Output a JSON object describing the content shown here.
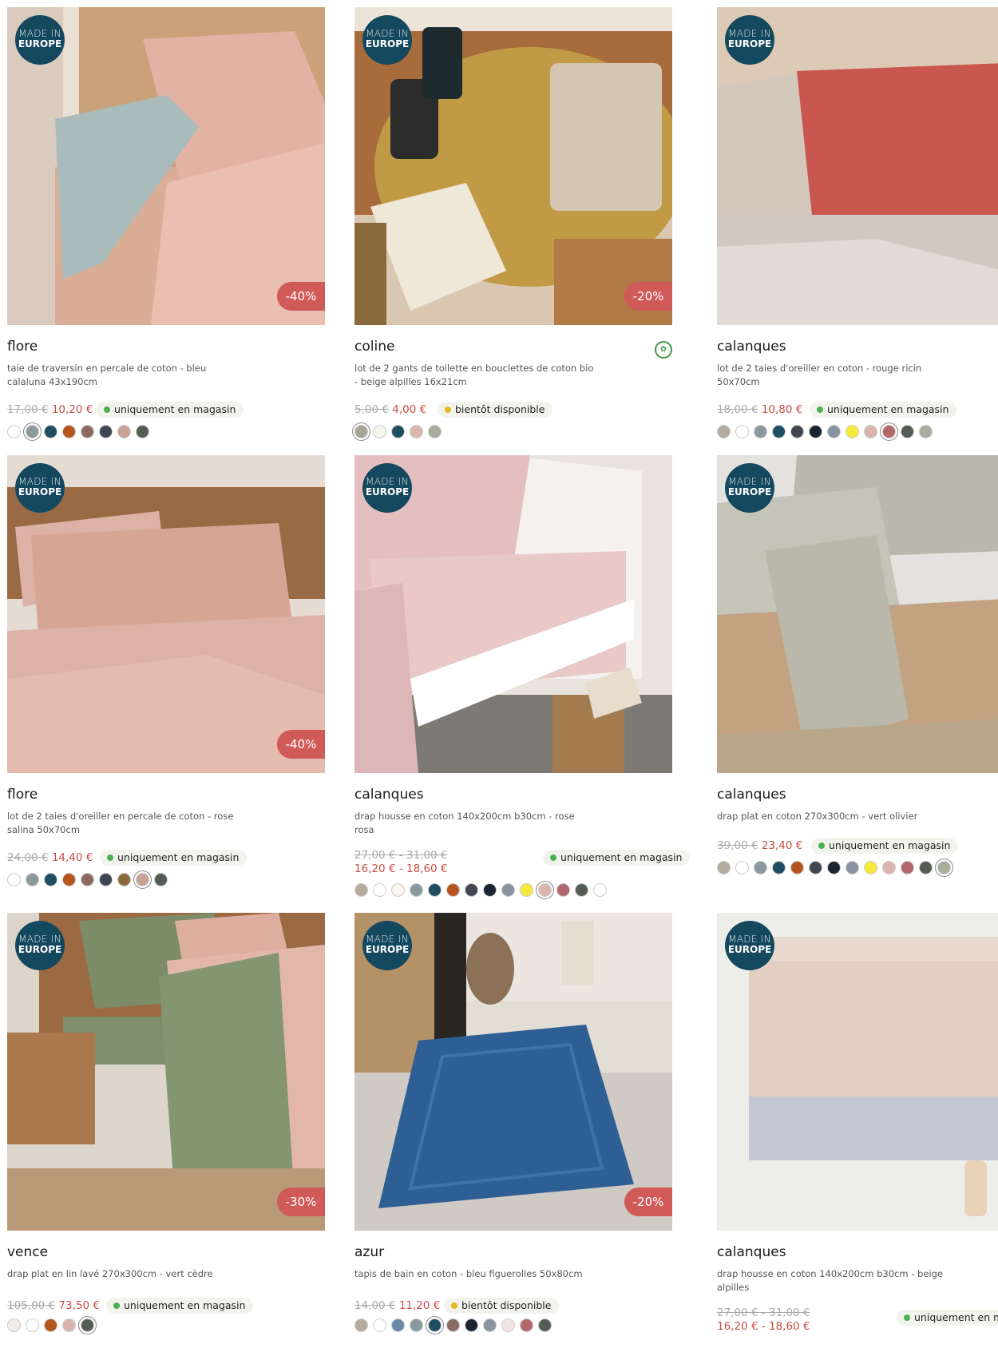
{
  "products": [
    {
      "brand": "flore",
      "desc": "taie de traversin en percale de coton - bleu calaluna 43x190cm",
      "old_price": "17,00 €",
      "new_price": "10,20 €",
      "discount": "-40%",
      "badge_l1": "MADE IN",
      "badge_l2": "EUROPE",
      "stock": "uniquement en magasin",
      "stock_color": "#4caf50",
      "swatches": [
        "#ffffff",
        "#8a9a9c",
        "#1f4e63",
        "#b4541f",
        "#8b6b60",
        "#404554",
        "#c9a394",
        "#535d55"
      ],
      "selected": 1
    },
    {
      "brand": "coline",
      "desc": "lot de 2 gants de toilette en bouclettes de coton bio - beige alpilles 16x21cm",
      "old_price": "5,00 €",
      "new_price": "4,00 €",
      "discount": "-20%",
      "badge_l1": "MADE IN",
      "badge_l2": "EUROPE",
      "stock": "bientôt disponible",
      "stock_color": "#e3b81f",
      "swatches": [
        "#a6a597",
        "#f7f5ea",
        "#1f4e63",
        "#d9b5ae",
        "#a9ad9b"
      ],
      "selected": 0,
      "bio_icon": "organic-certification-icon"
    },
    {
      "brand": "calanques",
      "desc": "lot de 2 taies d'oreiller en coton - rouge ricin 50x70cm",
      "old_price": "18,00 €",
      "new_price": "10,80 €",
      "discount": "",
      "badge_l1": "MADE IN",
      "badge_l2": "EUROPE",
      "stock": "uniquement en magasin",
      "stock_color": "#4caf50",
      "swatches": [
        "#b4ac9e",
        "#ffffff",
        "#8a9a9c",
        "#1f4e63",
        "#454750",
        "#1b2431",
        "#8a93a0",
        "#f5ea3c",
        "#d9b5ae",
        "#b3676a",
        "#535d55",
        "#a9ad9b"
      ],
      "selected": 9
    },
    {
      "brand": "flore",
      "desc": "lot de 2 taies d'oreiller en percale de coton - rose salina 50x70cm",
      "old_price": "24,00 €",
      "new_price": "14,40 €",
      "discount": "-40%",
      "badge_l1": "MADE IN",
      "badge_l2": "EUROPE",
      "stock": "uniquement en magasin",
      "stock_color": "#4caf50",
      "swatches": [
        "#ffffff",
        "#8a9a9c",
        "#1f4e63",
        "#b4541f",
        "#8b6b60",
        "#404554",
        "#8a6a3c",
        "#c9a394",
        "#535d55"
      ],
      "selected": 7
    },
    {
      "brand": "calanques",
      "desc": "drap housse en coton 140x200cm b30cm - rose rosa",
      "old_price": "27,00 € - 31,00 €",
      "new_price": "16,20 € - 18,60 €",
      "discount": "",
      "badge_l1": "MADE IN",
      "badge_l2": "EUROPE",
      "stock": "uniquement en magasin",
      "stock_color": "#4caf50",
      "swatches": [
        "#b4ac9e",
        "#ffffff",
        "#f7f5ea",
        "#8a9a9c",
        "#1f4e63",
        "#b4541f",
        "#454750",
        "#1b2431",
        "#8a93a0",
        "#f5ea3c",
        "#d9b5ae",
        "#b3676a",
        "#535d55",
        "#ffffff"
      ],
      "selected": 10
    },
    {
      "brand": "calanques",
      "desc": "drap plat en coton 270x300cm - vert olivier",
      "old_price": "39,00 €",
      "new_price": "23,40 €",
      "discount": "",
      "badge_l1": "MADE IN",
      "badge_l2": "EUROPE",
      "stock": "uniquement en magasin",
      "stock_color": "#4caf50",
      "swatches": [
        "#b4ac9e",
        "#ffffff",
        "#8a9a9c",
        "#1f4e63",
        "#b4541f",
        "#454750",
        "#1b2431",
        "#8a93a0",
        "#f5ea3c",
        "#d9b5ae",
        "#b3676a",
        "#535d55",
        "#a9ad9b"
      ],
      "selected": 12
    },
    {
      "brand": "vence",
      "desc": "drap plat en lin lavé 270x300cm - vert cèdre",
      "old_price": "105,00 €",
      "new_price": "73,50 €",
      "discount": "-30%",
      "badge_l1": "MADE IN",
      "badge_l2": "EUROPE",
      "stock": "uniquement en magasin",
      "stock_color": "#4caf50",
      "swatches": [
        "#f3ede5",
        "#ffffff",
        "#b4541f",
        "#d9b5ae",
        "#535d55"
      ],
      "selected": 4
    },
    {
      "brand": "azur",
      "desc": "tapis de bain en coton - bleu figuerolles 50x80cm",
      "old_price": "14,00 €",
      "new_price": "11,20 €",
      "discount": "-20%",
      "badge_l1": "MADE IN",
      "badge_l2": "EUROPE",
      "stock": "bientôt disponible",
      "stock_color": "#e3b81f",
      "swatches": [
        "#b4ac9e",
        "#ffffff",
        "#6a88a8",
        "#8a9a9c",
        "#1f4e63",
        "#8b6b60",
        "#1b2431",
        "#8a93a0",
        "#f2e6e3",
        "#b3676a",
        "#535d55"
      ],
      "selected": 4
    },
    {
      "brand": "calanques",
      "desc": "drap housse en coton 140x200cm b30cm - beige alpilles",
      "old_price": "27,00 € - 31,00 €",
      "new_price": "16,20 € - 18,60 €",
      "discount": "",
      "badge_l1": "MADE IN",
      "badge_l2": "EUROPE",
      "stock": "uniquement en magasin",
      "stock_color": "#4caf50",
      "swatches": [],
      "selected": -1
    }
  ]
}
